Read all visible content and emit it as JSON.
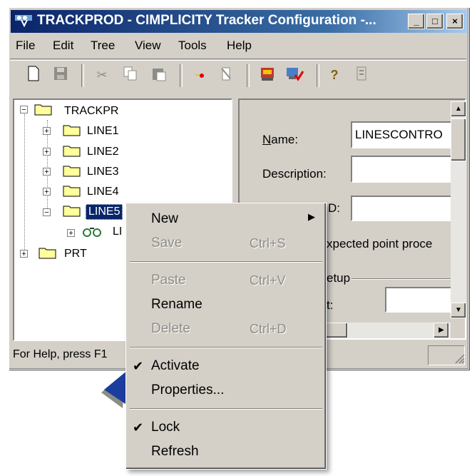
{
  "window": {
    "title": "TRACKPROD - CIMPLICITY Tracker Configuration -...",
    "caption_buttons": [
      "_",
      "□",
      "×"
    ]
  },
  "menubar": [
    "File",
    "Edit",
    "Tree",
    "View",
    "Tools",
    "Help"
  ],
  "toolbar": {
    "icons": [
      "new-icon",
      "save-icon",
      "cut-icon",
      "copy-icon",
      "paste-icon",
      "insert-icon",
      "delete-icon",
      "database-icon",
      "activate-icon",
      "help-icon",
      "info-icon"
    ]
  },
  "tree": {
    "root": "TRACKPR",
    "lines": [
      "LINE1",
      "LINE2",
      "LINE3",
      "LINE4",
      "LINE5"
    ],
    "selected_label": "LINE5",
    "child": "LI",
    "prt": "PRT"
  },
  "props": {
    "name_label": "Name:",
    "name_value": "LINESCONTRO",
    "description_label": "Description:",
    "description_value": "",
    "third_label": "D:",
    "expected_text": "xpected point proce",
    "setup_text": "etup",
    "t_label": "t:"
  },
  "status": {
    "text": "For Help, press F1"
  },
  "context_menu": {
    "new": "New",
    "save": "Save",
    "save_shortcut": "Ctrl+S",
    "paste": "Paste",
    "paste_shortcut": "Ctrl+V",
    "rename": "Rename",
    "delete": "Delete",
    "delete_shortcut": "Ctrl+D",
    "activate": "Activate",
    "properties": "Properties...",
    "lock": "Lock",
    "refresh": "Refresh"
  }
}
